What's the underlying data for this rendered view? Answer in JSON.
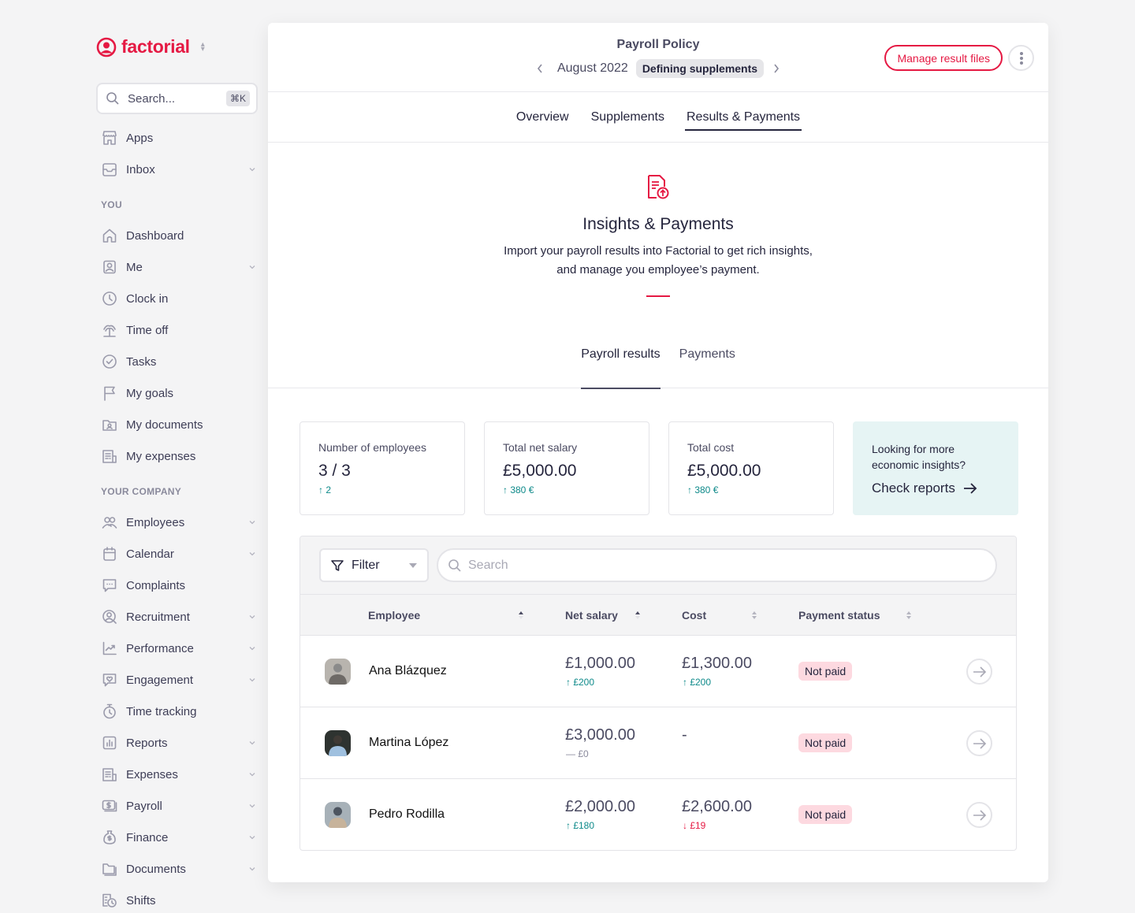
{
  "brand": {
    "name": "factorial",
    "color": "#e51943"
  },
  "sidebar": {
    "search_placeholder": "Search...",
    "search_shortcut": "⌘K",
    "top_items": [
      {
        "label": "Apps",
        "icon": "store-icon",
        "has_chevron": false
      },
      {
        "label": "Inbox",
        "icon": "inbox-icon",
        "has_chevron": true
      }
    ],
    "sections": [
      {
        "title": "YOU",
        "items": [
          {
            "label": "Dashboard",
            "icon": "home-icon",
            "has_chevron": false
          },
          {
            "label": "Me",
            "icon": "user-badge-icon",
            "has_chevron": true
          },
          {
            "label": "Clock in",
            "icon": "clock-icon",
            "has_chevron": false
          },
          {
            "label": "Time off",
            "icon": "palm-tree-icon",
            "has_chevron": false
          },
          {
            "label": "Tasks",
            "icon": "check-circle-icon",
            "has_chevron": false
          },
          {
            "label": "My goals",
            "icon": "flag-icon",
            "has_chevron": false
          },
          {
            "label": "My documents",
            "icon": "folder-user-icon",
            "has_chevron": false
          },
          {
            "label": "My expenses",
            "icon": "receipt-icon",
            "has_chevron": false
          }
        ]
      },
      {
        "title": "YOUR COMPANY",
        "items": [
          {
            "label": "Employees",
            "icon": "people-icon",
            "has_chevron": true
          },
          {
            "label": "Calendar",
            "icon": "calendar-icon",
            "has_chevron": true
          },
          {
            "label": "Complaints",
            "icon": "chat-icon",
            "has_chevron": false
          },
          {
            "label": "Recruitment",
            "icon": "recruitment-icon",
            "has_chevron": true
          },
          {
            "label": "Performance",
            "icon": "chart-line-icon",
            "has_chevron": true
          },
          {
            "label": "Engagement",
            "icon": "heart-chat-icon",
            "has_chevron": true
          },
          {
            "label": "Time tracking",
            "icon": "stopwatch-icon",
            "has_chevron": false
          },
          {
            "label": "Reports",
            "icon": "bar-chart-icon",
            "has_chevron": true
          },
          {
            "label": "Expenses",
            "icon": "receipt-icon",
            "has_chevron": true
          },
          {
            "label": "Payroll",
            "icon": "money-icon",
            "has_chevron": true
          },
          {
            "label": "Finance",
            "icon": "money-bag-icon",
            "has_chevron": true
          },
          {
            "label": "Documents",
            "icon": "folder-icon",
            "has_chevron": true
          },
          {
            "label": "Shifts",
            "icon": "shifts-icon",
            "has_chevron": false
          }
        ]
      }
    ]
  },
  "header": {
    "title": "Payroll Policy",
    "period": "August 2022",
    "status": "Defining supplements",
    "manage_button": "Manage result files"
  },
  "tabs": [
    {
      "label": "Overview",
      "active": false
    },
    {
      "label": "Supplements",
      "active": false
    },
    {
      "label": "Results & Payments",
      "active": true
    }
  ],
  "hero": {
    "title": "Insights & Payments",
    "description_line1": "Import your payroll results into Factorial to get rich insights,",
    "description_line2": "and manage you employee’s payment."
  },
  "subtabs": [
    {
      "label": "Payroll results",
      "active": true
    },
    {
      "label": "Payments",
      "active": false
    }
  ],
  "kpis": [
    {
      "label": "Number of employees",
      "value": "3 / 3",
      "delta": "↑ 2"
    },
    {
      "label": "Total net salary",
      "value": "£5,000.00",
      "delta": "↑ 380 €"
    },
    {
      "label": "Total cost",
      "value": "£5,000.00",
      "delta": "↑ 380 €"
    }
  ],
  "promo": {
    "line1": "Looking for more",
    "line2": "economic insights?",
    "link": "Check reports"
  },
  "table": {
    "filter_label": "Filter",
    "search_placeholder": "Search",
    "columns": [
      "Employee",
      "Net salary",
      "Cost",
      "Payment status"
    ],
    "rows": [
      {
        "name": "Ana Blázquez",
        "net": "£1,000.00",
        "net_delta": "↑ £200",
        "net_trend": "up",
        "cost": "£1,300.00",
        "cost_delta": "↑ £200",
        "cost_trend": "up",
        "status": "Not paid"
      },
      {
        "name": "Martina López",
        "net": "£3,000.00",
        "net_delta": "— £0",
        "net_trend": "flat",
        "cost": "-",
        "cost_delta": "",
        "cost_trend": "flat",
        "status": "Not paid"
      },
      {
        "name": "Pedro Rodilla",
        "net": "£2,000.00",
        "net_delta": "↑ £180",
        "net_trend": "up",
        "cost": "£2,600.00",
        "cost_delta": "↓ £19",
        "cost_trend": "down",
        "status": "Not paid"
      }
    ]
  }
}
